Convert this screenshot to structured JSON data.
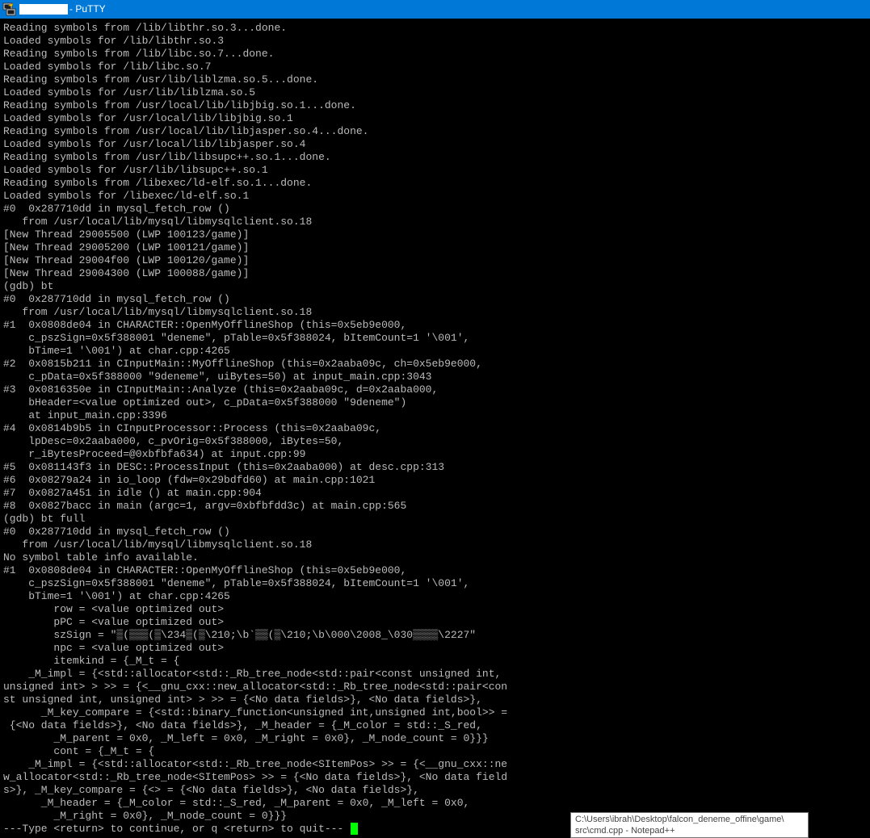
{
  "window": {
    "title": "- PuTTY",
    "title_redacted": true
  },
  "colors": {
    "titlebar": "#0078d7",
    "terminal_bg": "#000000",
    "terminal_fg": "#bbbbbb",
    "cursor": "#00ff00"
  },
  "terminal": {
    "lines": [
      "Reading symbols from /lib/libthr.so.3...done.",
      "Loaded symbols for /lib/libthr.so.3",
      "Reading symbols from /lib/libc.so.7...done.",
      "Loaded symbols for /lib/libc.so.7",
      "Reading symbols from /usr/lib/liblzma.so.5...done.",
      "Loaded symbols for /usr/lib/liblzma.so.5",
      "Reading symbols from /usr/local/lib/libjbig.so.1...done.",
      "Loaded symbols for /usr/local/lib/libjbig.so.1",
      "Reading symbols from /usr/local/lib/libjasper.so.4...done.",
      "Loaded symbols for /usr/local/lib/libjasper.so.4",
      "Reading symbols from /usr/lib/libsupc++.so.1...done.",
      "Loaded symbols for /usr/lib/libsupc++.so.1",
      "Reading symbols from /libexec/ld-elf.so.1...done.",
      "Loaded symbols for /libexec/ld-elf.so.1",
      "#0  0x287710dd in mysql_fetch_row ()",
      "   from /usr/local/lib/mysql/libmysqlclient.so.18",
      "[New Thread 29005500 (LWP 100123/game)]",
      "[New Thread 29005200 (LWP 100121/game)]",
      "[New Thread 29004f00 (LWP 100120/game)]",
      "[New Thread 29004300 (LWP 100088/game)]",
      "(gdb) bt",
      "#0  0x287710dd in mysql_fetch_row ()",
      "   from /usr/local/lib/mysql/libmysqlclient.so.18",
      "#1  0x0808de04 in CHARACTER::OpenMyOfflineShop (this=0x5eb9e000,",
      "    c_pszSign=0x5f388001 \"deneme\", pTable=0x5f388024, bItemCount=1 '\\001',",
      "    bTime=1 '\\001') at char.cpp:4265",
      "#2  0x0815b211 in CInputMain::MyOfflineShop (this=0x2aaba09c, ch=0x5eb9e000,",
      "    c_pData=0x5f388000 \"9deneme\", uiBytes=50) at input_main.cpp:3043",
      "#3  0x0816350e in CInputMain::Analyze (this=0x2aaba09c, d=0x2aaba000,",
      "    bHeader=<value optimized out>, c_pData=0x5f388000 \"9deneme\")",
      "    at input_main.cpp:3396",
      "#4  0x0814b9b5 in CInputProcessor::Process (this=0x2aaba09c,",
      "    lpDesc=0x2aaba000, c_pvOrig=0x5f388000, iBytes=50,",
      "    r_iBytesProceed=@0xbfbfa634) at input.cpp:99",
      "#5  0x081143f3 in DESC::ProcessInput (this=0x2aaba000) at desc.cpp:313",
      "#6  0x08279a24 in io_loop (fdw=0x29bdfd60) at main.cpp:1021",
      "#7  0x0827a451 in idle () at main.cpp:904",
      "#8  0x0827bacc in main (argc=1, argv=0xbfbfdd3c) at main.cpp:565",
      "(gdb) bt full",
      "#0  0x287710dd in mysql_fetch_row ()",
      "   from /usr/local/lib/mysql/libmysqlclient.so.18",
      "No symbol table info available.",
      "#1  0x0808de04 in CHARACTER::OpenMyOfflineShop (this=0x5eb9e000,",
      "    c_pszSign=0x5f388001 \"deneme\", pTable=0x5f388024, bItemCount=1 '\\001',",
      "    bTime=1 '\\001') at char.cpp:4265",
      "        row = <value optimized out>",
      "        pPC = <value optimized out>",
      "        szSign = \"▒(▒▒▒(▒\\234▒(▒\\210;\\b`▒▒(▒\\210;\\b\\000\\2008_\\030▒▒▒▒\\2227\"",
      "        npc = <value optimized out>",
      "        itemkind = {_M_t = {",
      "    _M_impl = {<std::allocator<std::_Rb_tree_node<std::pair<const unsigned int,",
      "unsigned int> > >> = {<__gnu_cxx::new_allocator<std::_Rb_tree_node<std::pair<con",
      "st unsigned int, unsigned int> > >> = {<No data fields>}, <No data fields>},",
      "      _M_key_compare = {<std::binary_function<unsigned int,unsigned int,bool>> =",
      " {<No data fields>}, <No data fields>}, _M_header = {_M_color = std::_S_red,",
      "        _M_parent = 0x0, _M_left = 0x0, _M_right = 0x0}, _M_node_count = 0}}}",
      "        cont = {_M_t = {",
      "    _M_impl = {<std::allocator<std::_Rb_tree_node<SItemPos> >> = {<__gnu_cxx::ne",
      "w_allocator<std::_Rb_tree_node<SItemPos> >> = {<No data fields>}, <No data field",
      "s>}, _M_key_compare = {<> = {<No data fields>}, <No data fields>},",
      "      _M_header = {_M_color = std::_S_red, _M_parent = 0x0, _M_left = 0x0,",
      "        _M_right = 0x0}, _M_node_count = 0}}}",
      "---Type <return> to continue, or q <return> to quit---"
    ]
  },
  "tooltip": {
    "line1": "C:\\Users\\ibrah\\Desktop\\falcon_deneme_offine\\game\\",
    "line2": "src\\cmd.cpp - Notepad++"
  }
}
